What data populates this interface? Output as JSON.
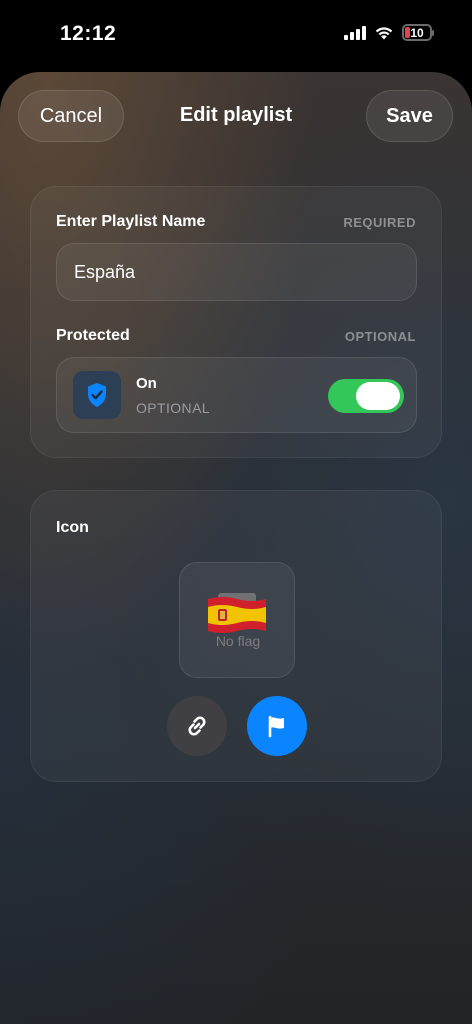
{
  "status_bar": {
    "time": "12:12",
    "battery_level": "10"
  },
  "header": {
    "cancel_label": "Cancel",
    "title": "Edit playlist",
    "save_label": "Save"
  },
  "name_section": {
    "label": "Enter Playlist Name",
    "tag": "REQUIRED",
    "value": "España"
  },
  "protected_section": {
    "label": "Protected",
    "tag": "OPTIONAL",
    "state_label": "On",
    "state_sublabel": "OPTIONAL",
    "toggle_on": true
  },
  "icon_section": {
    "label": "Icon",
    "placeholder_text": "No flag",
    "selected_flag": "Spain"
  },
  "colors": {
    "accent": "#0a84ff",
    "toggle_green": "#33c759",
    "battery_red": "#e5434d"
  }
}
